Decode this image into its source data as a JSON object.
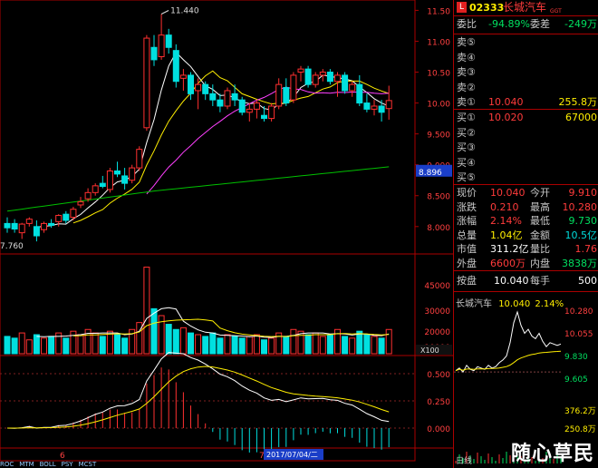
{
  "stock": {
    "code": "02333",
    "name": "长城汽车",
    "suffix": "GGT",
    "badge": "L"
  },
  "order_book": {
    "wei_bi_label": "委比",
    "wei_bi": "-94.89%",
    "wei_cha_label": "委差",
    "wei_cha": "-249万",
    "asks": [
      {
        "label": "卖⑤",
        "price": "",
        "vol": ""
      },
      {
        "label": "卖④",
        "price": "",
        "vol": ""
      },
      {
        "label": "卖③",
        "price": "",
        "vol": ""
      },
      {
        "label": "卖②",
        "price": "",
        "vol": ""
      },
      {
        "label": "卖①",
        "price": "10.040",
        "vol": "255.8万"
      }
    ],
    "bids": [
      {
        "label": "买①",
        "price": "10.020",
        "vol": "67000"
      },
      {
        "label": "买②",
        "price": "",
        "vol": ""
      },
      {
        "label": "买③",
        "price": "",
        "vol": ""
      },
      {
        "label": "买④",
        "price": "",
        "vol": ""
      },
      {
        "label": "买⑤",
        "price": "",
        "vol": ""
      }
    ]
  },
  "quote": {
    "rows": [
      {
        "l1": "现价",
        "v1": "10.040",
        "l2": "今开",
        "v2": "9.910"
      },
      {
        "l1": "涨跌",
        "v1": "0.210",
        "l2": "最高",
        "v2": "10.280"
      },
      {
        "l1": "涨幅",
        "v1": "2.14%",
        "l2": "最低",
        "v2": "9.730"
      },
      {
        "l1": "总量",
        "v1": "1.04亿",
        "l2": "金额",
        "v2": "10.5亿"
      },
      {
        "l1": "市值",
        "v1": "311.2亿",
        "l2": "量比",
        "v2": "1.76"
      },
      {
        "l1": "外盘",
        "v1": "6600万",
        "l2": "内盘",
        "v2": "3838万"
      }
    ],
    "an_pan_label": "按盘",
    "an_pan": "10.040",
    "mei_shou_label": "每手",
    "mei_shou": "500"
  },
  "mini_chart": {
    "title": "长城汽车",
    "price": "10.040",
    "pct": "2.14%",
    "y_labels": [
      "10.280",
      "10.055",
      "9.830",
      "9.605",
      "376.2万",
      "250.8万"
    ],
    "footer": "日线"
  },
  "kline": {
    "price_axis": [
      "11.50",
      "11.00",
      "10.50",
      "10.00",
      "9.500",
      "9.000",
      "8.500",
      "8.000"
    ],
    "current_label": "8.896",
    "high_label": "11.440",
    "low_label": "7.760",
    "vol_axis": [
      "45000",
      "30000",
      "20000",
      "10000",
      "X100"
    ],
    "macd_axis": [
      "0.500",
      "0.250",
      "0.000"
    ],
    "month_labels": [
      "6",
      "7"
    ],
    "date_label": "2017/07/04/二",
    "candles": [
      {
        "o": 8.05,
        "h": 8.15,
        "l": 7.9,
        "c": 7.98
      },
      {
        "o": 8.05,
        "h": 8.12,
        "l": 7.9,
        "c": 7.96
      },
      {
        "o": 7.9,
        "h": 8.06,
        "l": 7.8,
        "c": 8.04
      },
      {
        "o": 8.05,
        "h": 8.15,
        "l": 8.0,
        "c": 8.12
      },
      {
        "o": 8.0,
        "h": 8.1,
        "l": 7.76,
        "c": 7.85
      },
      {
        "o": 7.95,
        "h": 8.08,
        "l": 7.9,
        "c": 8.05
      },
      {
        "o": 8.05,
        "h": 8.12,
        "l": 7.98,
        "c": 8.02
      },
      {
        "o": 8.08,
        "h": 8.2,
        "l": 8.0,
        "c": 8.18
      },
      {
        "o": 8.2,
        "h": 8.25,
        "l": 8.05,
        "c": 8.1
      },
      {
        "o": 8.15,
        "h": 8.32,
        "l": 8.1,
        "c": 8.28
      },
      {
        "o": 8.35,
        "h": 8.48,
        "l": 8.3,
        "c": 8.4
      },
      {
        "o": 8.45,
        "h": 8.62,
        "l": 8.4,
        "c": 8.55
      },
      {
        "o": 8.55,
        "h": 8.7,
        "l": 8.5,
        "c": 8.66
      },
      {
        "o": 8.7,
        "h": 8.82,
        "l": 8.62,
        "c": 8.65
      },
      {
        "o": 8.6,
        "h": 8.95,
        "l": 8.55,
        "c": 8.9
      },
      {
        "o": 8.9,
        "h": 9.05,
        "l": 8.8,
        "c": 8.85
      },
      {
        "o": 8.82,
        "h": 8.95,
        "l": 8.6,
        "c": 8.7
      },
      {
        "o": 8.75,
        "h": 9.0,
        "l": 8.7,
        "c": 8.95
      },
      {
        "o": 8.95,
        "h": 9.3,
        "l": 8.9,
        "c": 9.25
      },
      {
        "o": 9.6,
        "h": 11.1,
        "l": 9.55,
        "c": 11.05
      },
      {
        "o": 10.9,
        "h": 11.1,
        "l": 10.6,
        "c": 10.7
      },
      {
        "o": 10.75,
        "h": 11.44,
        "l": 10.7,
        "c": 11.1
      },
      {
        "o": 11.1,
        "h": 11.2,
        "l": 10.8,
        "c": 10.9
      },
      {
        "o": 10.85,
        "h": 10.95,
        "l": 10.25,
        "c": 10.35
      },
      {
        "o": 10.4,
        "h": 10.55,
        "l": 10.2,
        "c": 10.45
      },
      {
        "o": 10.45,
        "h": 10.5,
        "l": 10.05,
        "c": 10.15
      },
      {
        "o": 10.2,
        "h": 10.4,
        "l": 9.9,
        "c": 10.3
      },
      {
        "o": 10.3,
        "h": 10.35,
        "l": 10.05,
        "c": 10.15
      },
      {
        "o": 10.15,
        "h": 10.3,
        "l": 9.95,
        "c": 10.05
      },
      {
        "o": 10.05,
        "h": 10.15,
        "l": 9.85,
        "c": 9.95
      },
      {
        "o": 9.95,
        "h": 10.25,
        "l": 9.9,
        "c": 10.2
      },
      {
        "o": 10.15,
        "h": 10.3,
        "l": 9.95,
        "c": 10.05
      },
      {
        "o": 10.05,
        "h": 10.1,
        "l": 9.8,
        "c": 9.85
      },
      {
        "o": 9.85,
        "h": 10.0,
        "l": 9.7,
        "c": 9.9
      },
      {
        "o": 9.9,
        "h": 10.05,
        "l": 9.75,
        "c": 10.0
      },
      {
        "o": 9.8,
        "h": 9.95,
        "l": 9.7,
        "c": 9.75
      },
      {
        "o": 9.75,
        "h": 10.0,
        "l": 9.7,
        "c": 9.95
      },
      {
        "o": 9.95,
        "h": 10.4,
        "l": 9.9,
        "c": 10.3
      },
      {
        "o": 10.25,
        "h": 10.4,
        "l": 9.95,
        "c": 10.0
      },
      {
        "o": 10.05,
        "h": 10.5,
        "l": 10.0,
        "c": 10.45
      },
      {
        "o": 10.5,
        "h": 10.6,
        "l": 10.35,
        "c": 10.55
      },
      {
        "o": 10.55,
        "h": 10.6,
        "l": 10.25,
        "c": 10.3
      },
      {
        "o": 10.3,
        "h": 10.5,
        "l": 10.25,
        "c": 10.45
      },
      {
        "o": 10.45,
        "h": 10.55,
        "l": 10.35,
        "c": 10.5
      },
      {
        "o": 10.5,
        "h": 10.55,
        "l": 10.3,
        "c": 10.35
      },
      {
        "o": 10.35,
        "h": 10.5,
        "l": 10.1,
        "c": 10.45
      },
      {
        "o": 10.45,
        "h": 10.5,
        "l": 10.15,
        "c": 10.2
      },
      {
        "o": 10.2,
        "h": 10.35,
        "l": 10.1,
        "c": 10.3
      },
      {
        "o": 10.3,
        "h": 10.45,
        "l": 9.95,
        "c": 10.0
      },
      {
        "o": 10.0,
        "h": 10.15,
        "l": 9.85,
        "c": 9.9
      },
      {
        "o": 9.9,
        "h": 10.05,
        "l": 9.8,
        "c": 9.95
      },
      {
        "o": 9.95,
        "h": 10.05,
        "l": 9.7,
        "c": 9.85
      },
      {
        "o": 9.91,
        "h": 10.28,
        "l": 9.73,
        "c": 10.04
      }
    ],
    "volumes": [
      10,
      9,
      12,
      8,
      11,
      9,
      10,
      12,
      9,
      13,
      11,
      14,
      12,
      10,
      13,
      11,
      9,
      14,
      18,
      50,
      26,
      22,
      17,
      14,
      15,
      12,
      11,
      10,
      12,
      9,
      11,
      10,
      9,
      10,
      11,
      8,
      9,
      12,
      10,
      14,
      13,
      11,
      12,
      10,
      11,
      14,
      10,
      9,
      13,
      11,
      10,
      9,
      14
    ]
  }
}
